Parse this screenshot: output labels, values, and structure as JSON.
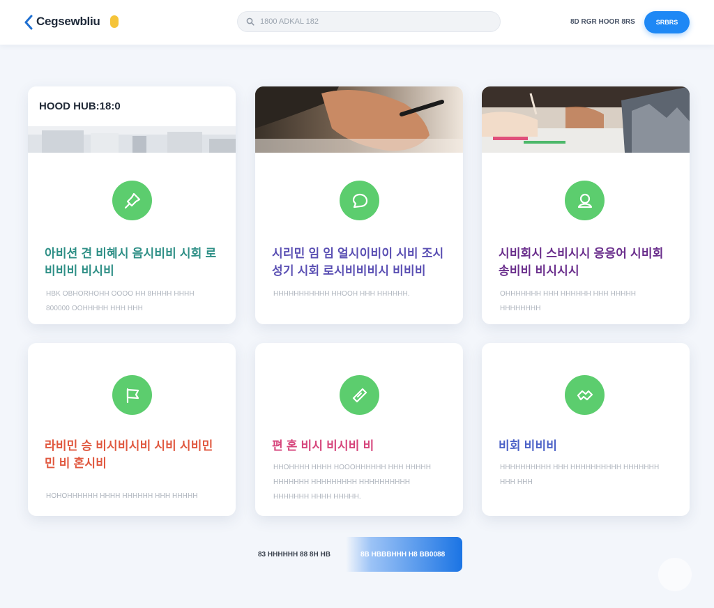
{
  "header": {
    "brand": "Cegsewbliu",
    "search_placeholder": "1800 ADKAL 182",
    "nav_link": "8D RGR HOOR 8RS",
    "cta_label": "SRBRS"
  },
  "cards": [
    {
      "header_title": "HOOD HUB:18:0",
      "title": "아비션 견 비혜시 음시비비 시회 로비비비 비시비",
      "title_color": "#2e8f86",
      "desc": "HBK OBHORHOHH OOOO HH 8HHHH HHHH 800000 OOHHHHH HHH HHH",
      "icon": "pushpin-icon"
    },
    {
      "title": "시리민 임 임 얼시이비이 시비 조시성기 시회 로시비비비시 비비비",
      "title_color": "#5a4fb3",
      "desc": "HHHHHHHHHHH HHOOH HHH HHHHHH.",
      "icon": "chat-bubble-icon"
    },
    {
      "title": "시비회시 스비시시 응응어 시비회 송비비 비시시시",
      "title_color": "#6a2e8c",
      "desc": "OHHHHHHH HHH HHHHHH HHH HHHHH HHHHHHHH",
      "icon": "user-icon"
    },
    {
      "title": "라비민 승 비시비시비 시비 시비민민 비 혼시비",
      "title_color": "#e0583f",
      "desc": "HOHOHHHHHH HHHH HHHHHH HHH HHHHH",
      "icon": "flag-icon"
    },
    {
      "title": "편 혼 비시 비시비 비",
      "title_color": "#d6457c",
      "desc": "HHOHHHH HHHH HOOOHHHHHH HHH HHHHH HHHHHHH HHHHHHHHH HHHHHHHHHH HHHHHHH HHHH HHHHH.",
      "icon": "ticket-icon"
    },
    {
      "title": "비회 비비비",
      "title_color": "#4c62c7",
      "desc": "HHHHHHHHHH HHH HHHHHHHHHH HHHHHHH HHH HHH",
      "icon": "handshake-icon"
    }
  ],
  "footer_cta": {
    "left_label": "83 HHHHHH 88 8H HB",
    "right_label": "8B HBBBHHH H8 BB0088"
  },
  "colors": {
    "accent": "#1e88f5",
    "icon_green": "#5ccd6e",
    "background": "#f3f6fb"
  }
}
